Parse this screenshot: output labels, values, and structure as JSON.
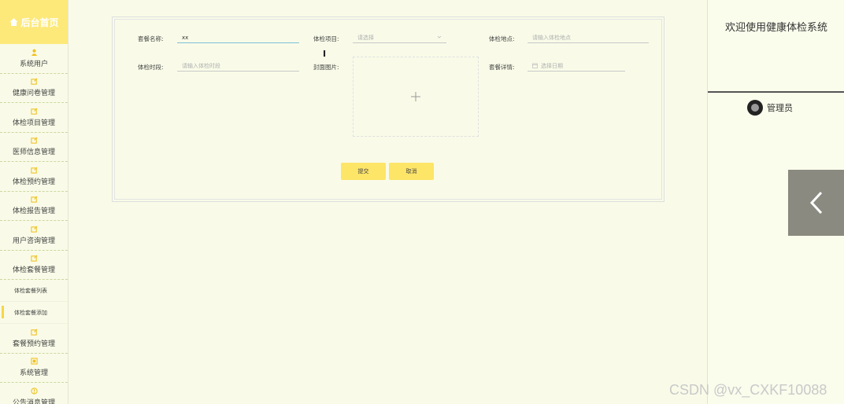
{
  "sidebar": {
    "brand": "后台首页",
    "items": [
      {
        "label": "系统用户",
        "icon": "user-icon"
      },
      {
        "label": "健康问卷管理",
        "icon": "edit-icon"
      },
      {
        "label": "体检项目管理",
        "icon": "edit-icon"
      },
      {
        "label": "医师信息管理",
        "icon": "edit-icon"
      },
      {
        "label": "体检预约管理",
        "icon": "edit-icon"
      },
      {
        "label": "体检报告管理",
        "icon": "edit-icon"
      },
      {
        "label": "用户咨询管理",
        "icon": "edit-icon"
      },
      {
        "label": "体检套餐管理",
        "icon": "edit-icon"
      }
    ],
    "sub_items": [
      {
        "label": "体检套餐列表"
      },
      {
        "label": "体检套餐添加"
      }
    ],
    "items_after": [
      {
        "label": "套餐预约管理",
        "icon": "edit-icon"
      },
      {
        "label": "系统管理",
        "icon": "settings-icon"
      },
      {
        "label": "公告消息管理",
        "icon": "info-icon"
      }
    ]
  },
  "form": {
    "package_name": {
      "label": "套餐名称:",
      "value": "xx"
    },
    "exam_items": {
      "label": "体检项目:",
      "placeholder": "请选择"
    },
    "exam_location": {
      "label": "体检地点:",
      "placeholder": "请输入体检地点"
    },
    "exam_time": {
      "label": "体检时段:",
      "placeholder": "请输入体检时段"
    },
    "cover_image": {
      "label": "封面图片:"
    },
    "package_details": {
      "label": "套餐详情:",
      "placeholder": "选择日期"
    },
    "submit_label": "提交",
    "cancel_label": "取消"
  },
  "right_panel": {
    "welcome": "欢迎使用健康体检系统",
    "user_name": "管理员"
  },
  "watermark": "CSDN @vx_CXKF10088"
}
